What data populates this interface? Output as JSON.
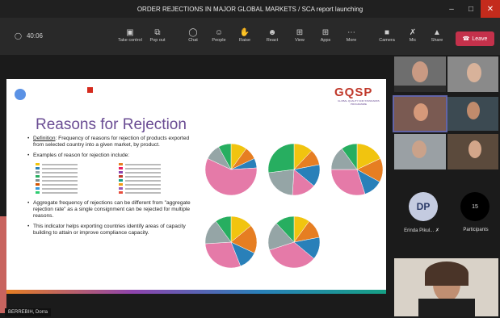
{
  "window": {
    "title": "ORDER REJECTIONS IN MAJOR GLOBAL MARKETS / SCA report launching"
  },
  "toolbar": {
    "timer": "40:06",
    "buttons": [
      {
        "label": "Take control",
        "icon": "take-control-icon"
      },
      {
        "label": "Pop out",
        "icon": "pop-out-icon"
      },
      {
        "label": "Chat",
        "icon": "chat-icon"
      },
      {
        "label": "People",
        "icon": "people-icon"
      },
      {
        "label": "Raise",
        "icon": "raise-hand-icon"
      },
      {
        "label": "React",
        "icon": "react-icon"
      },
      {
        "label": "View",
        "icon": "view-icon"
      },
      {
        "label": "Apps",
        "icon": "apps-icon"
      },
      {
        "label": "More",
        "icon": "more-icon"
      },
      {
        "label": "Camera",
        "icon": "camera-icon"
      },
      {
        "label": "Mic",
        "icon": "mic-off-icon"
      },
      {
        "label": "Share",
        "icon": "share-icon"
      }
    ],
    "leave_label": "Leave"
  },
  "slide": {
    "title": "Reasons for Rejection",
    "definition_term": "Definition",
    "definition_text": ": Frequency of reasons for rejection of products exported from selected country into a given market, by product.",
    "examples_heading": "Examples of reason for rejection include:",
    "bullet2": "Aggregate frequency of rejections can be different from \"aggregate rejection rate\" as a single consignment can be rejected for multiple reasons.",
    "bullet3": "This indicator helps exporting countries identify areas of capacity building to attain or improve compliance capacity.",
    "logo_text": "GQSP",
    "logo_subtext": "GLOBAL QUALITY AND STANDARDS PROGRAMME"
  },
  "participants": {
    "avatar_initials": "DP",
    "avatar_name": "Erinda Pikul...",
    "participants_count": "15",
    "participants_label": "Participants"
  },
  "speaker_name": "BERREBIH, Dorra",
  "colors": {
    "accent": "#6264a7",
    "leave": "#c4314b",
    "slide_title": "#6a4c93"
  },
  "reason_swatches": [
    "#f1c40f",
    "#e67e22",
    "#2980b9",
    "#e91e63",
    "#95a5a6",
    "#8e44ad",
    "#27ae60",
    "#c0392b",
    "#7f8c8d",
    "#16a085",
    "#d35400",
    "#f39c12",
    "#3498db",
    "#9b59b6",
    "#2ecc71",
    "#e74c3c"
  ],
  "chart_data": [
    {
      "type": "pie",
      "series": [
        {
          "values": [
            10,
            8,
            6,
            58,
            10,
            8
          ]
        }
      ]
    },
    {
      "type": "pie",
      "series": [
        {
          "values": [
            12,
            10,
            14,
            15,
            22,
            27
          ]
        }
      ]
    },
    {
      "type": "pie",
      "series": [
        {
          "values": [
            18,
            15,
            12,
            30,
            15,
            10
          ]
        }
      ]
    },
    {
      "type": "pie",
      "series": [
        {
          "values": [
            14,
            18,
            12,
            30,
            16,
            10
          ]
        }
      ]
    },
    {
      "type": "pie",
      "series": [
        {
          "values": [
            10,
            12,
            14,
            34,
            18,
            12
          ]
        }
      ]
    }
  ]
}
